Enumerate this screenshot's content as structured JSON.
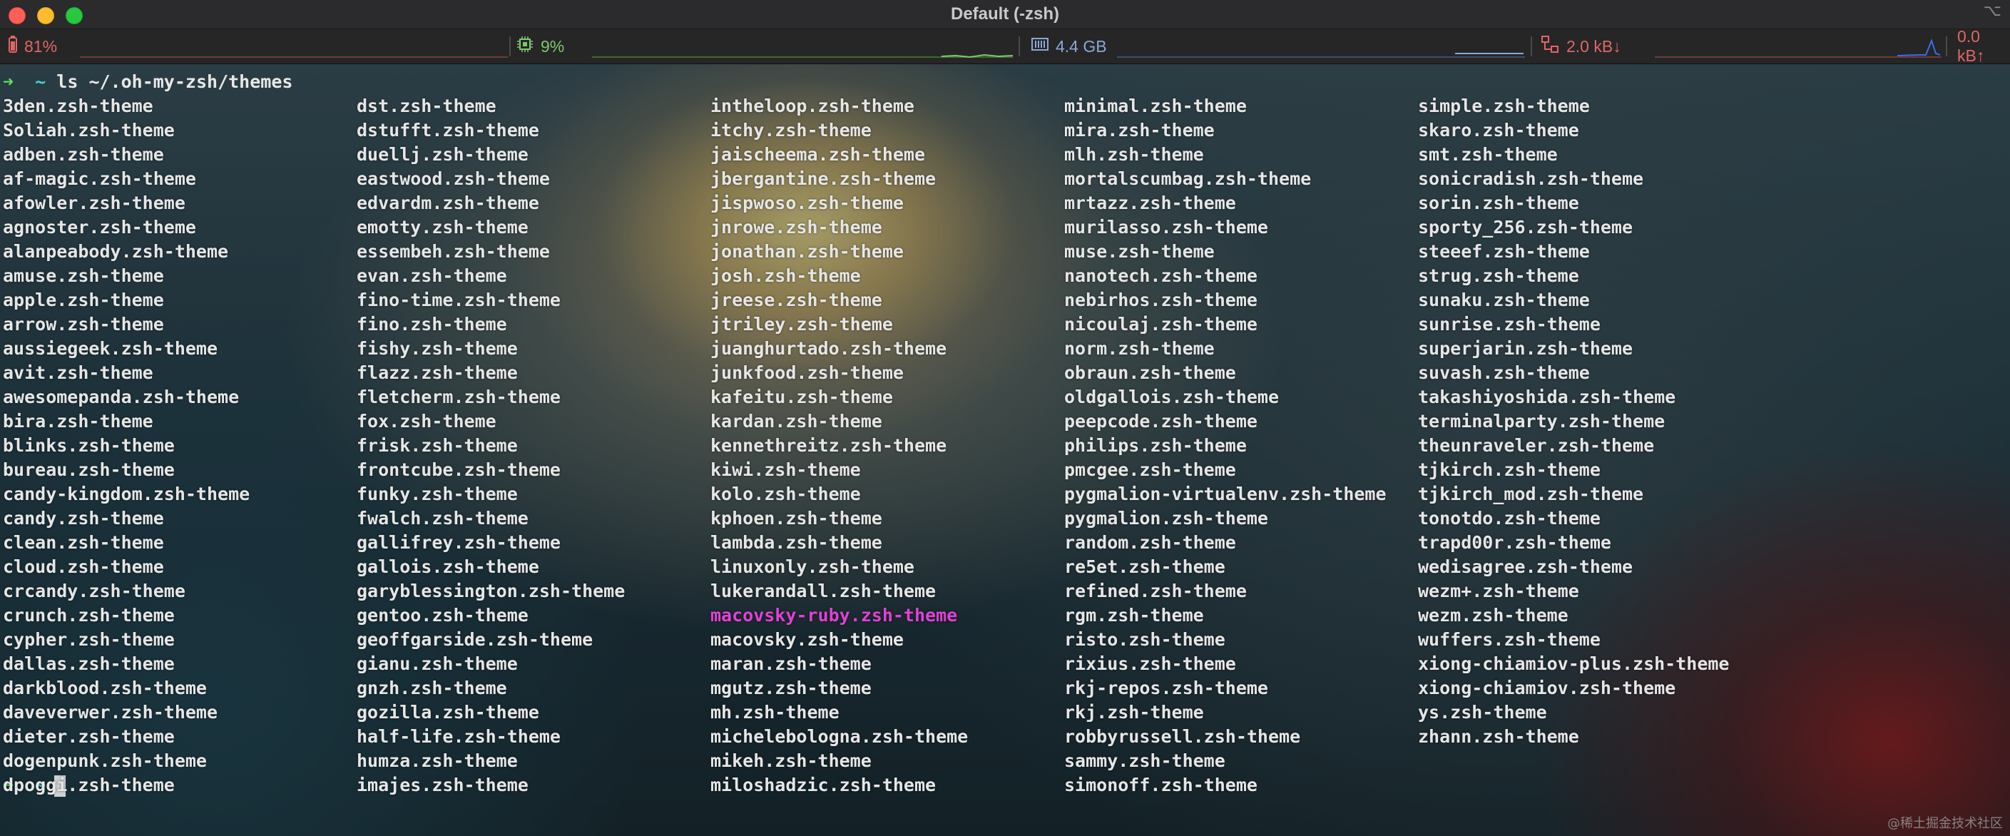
{
  "window": {
    "title": "Default (-zsh)",
    "title_icon": "⌥"
  },
  "statusbar": {
    "battery": {
      "value": "81%",
      "icon": "battery-icon",
      "color": "#e06666"
    },
    "cpu": {
      "value": "9%",
      "icon": "cpu-icon",
      "color": "#7ec96b"
    },
    "memory": {
      "value": "4.4 GB",
      "icon": "memory-icon",
      "color": "#8aa8d8"
    },
    "network_down": {
      "value": "2.0 kB↓",
      "icon": "network-icon",
      "color": "#e06666"
    },
    "network_up": {
      "value": "0.0 kB↑",
      "color": "#e06666"
    }
  },
  "terminal": {
    "prompt_arrow": "➜",
    "prompt_dir": "~",
    "command": "ls ~/.oh-my-zsh/themes",
    "highlighted_item": "macovsky-ruby.zsh-theme",
    "highlight_color": "#e141d6",
    "columns": [
      [
        "3den.zsh-theme",
        "Soliah.zsh-theme",
        "adben.zsh-theme",
        "af-magic.zsh-theme",
        "afowler.zsh-theme",
        "agnoster.zsh-theme",
        "alanpeabody.zsh-theme",
        "amuse.zsh-theme",
        "apple.zsh-theme",
        "arrow.zsh-theme",
        "aussiegeek.zsh-theme",
        "avit.zsh-theme",
        "awesomepanda.zsh-theme",
        "bira.zsh-theme",
        "blinks.zsh-theme",
        "bureau.zsh-theme",
        "candy-kingdom.zsh-theme",
        "candy.zsh-theme",
        "clean.zsh-theme",
        "cloud.zsh-theme",
        "crcandy.zsh-theme",
        "crunch.zsh-theme",
        "cypher.zsh-theme",
        "dallas.zsh-theme",
        "darkblood.zsh-theme",
        "daveverwer.zsh-theme",
        "dieter.zsh-theme",
        "dogenpunk.zsh-theme",
        "dpoggi.zsh-theme"
      ],
      [
        "dst.zsh-theme",
        "dstufft.zsh-theme",
        "duellj.zsh-theme",
        "eastwood.zsh-theme",
        "edvardm.zsh-theme",
        "emotty.zsh-theme",
        "essembeh.zsh-theme",
        "evan.zsh-theme",
        "fino-time.zsh-theme",
        "fino.zsh-theme",
        "fishy.zsh-theme",
        "flazz.zsh-theme",
        "fletcherm.zsh-theme",
        "fox.zsh-theme",
        "frisk.zsh-theme",
        "frontcube.zsh-theme",
        "funky.zsh-theme",
        "fwalch.zsh-theme",
        "gallifrey.zsh-theme",
        "gallois.zsh-theme",
        "garyblessington.zsh-theme",
        "gentoo.zsh-theme",
        "geoffgarside.zsh-theme",
        "gianu.zsh-theme",
        "gnzh.zsh-theme",
        "gozilla.zsh-theme",
        "half-life.zsh-theme",
        "humza.zsh-theme",
        "imajes.zsh-theme"
      ],
      [
        "intheloop.zsh-theme",
        "itchy.zsh-theme",
        "jaischeema.zsh-theme",
        "jbergantine.zsh-theme",
        "jispwoso.zsh-theme",
        "jnrowe.zsh-theme",
        "jonathan.zsh-theme",
        "josh.zsh-theme",
        "jreese.zsh-theme",
        "jtriley.zsh-theme",
        "juanghurtado.zsh-theme",
        "junkfood.zsh-theme",
        "kafeitu.zsh-theme",
        "kardan.zsh-theme",
        "kennethreitz.zsh-theme",
        "kiwi.zsh-theme",
        "kolo.zsh-theme",
        "kphoen.zsh-theme",
        "lambda.zsh-theme",
        "linuxonly.zsh-theme",
        "lukerandall.zsh-theme",
        "macovsky-ruby.zsh-theme",
        "macovsky.zsh-theme",
        "maran.zsh-theme",
        "mgutz.zsh-theme",
        "mh.zsh-theme",
        "michelebologna.zsh-theme",
        "mikeh.zsh-theme",
        "miloshadzic.zsh-theme"
      ],
      [
        "minimal.zsh-theme",
        "mira.zsh-theme",
        "mlh.zsh-theme",
        "mortalscumbag.zsh-theme",
        "mrtazz.zsh-theme",
        "murilasso.zsh-theme",
        "muse.zsh-theme",
        "nanotech.zsh-theme",
        "nebirhos.zsh-theme",
        "nicoulaj.zsh-theme",
        "norm.zsh-theme",
        "obraun.zsh-theme",
        "oldgallois.zsh-theme",
        "peepcode.zsh-theme",
        "philips.zsh-theme",
        "pmcgee.zsh-theme",
        "pygmalion-virtualenv.zsh-theme",
        "pygmalion.zsh-theme",
        "random.zsh-theme",
        "re5et.zsh-theme",
        "refined.zsh-theme",
        "rgm.zsh-theme",
        "risto.zsh-theme",
        "rixius.zsh-theme",
        "rkj-repos.zsh-theme",
        "rkj.zsh-theme",
        "robbyrussell.zsh-theme",
        "sammy.zsh-theme",
        "simonoff.zsh-theme"
      ],
      [
        "simple.zsh-theme",
        "skaro.zsh-theme",
        "smt.zsh-theme",
        "sonicradish.zsh-theme",
        "sorin.zsh-theme",
        "sporty_256.zsh-theme",
        "steeef.zsh-theme",
        "strug.zsh-theme",
        "sunaku.zsh-theme",
        "sunrise.zsh-theme",
        "superjarin.zsh-theme",
        "suvash.zsh-theme",
        "takashiyoshida.zsh-theme",
        "terminalparty.zsh-theme",
        "theunraveler.zsh-theme",
        "tjkirch.zsh-theme",
        "tjkirch_mod.zsh-theme",
        "tonotdo.zsh-theme",
        "trapd00r.zsh-theme",
        "wedisagree.zsh-theme",
        "wezm+.zsh-theme",
        "wezm.zsh-theme",
        "wuffers.zsh-theme",
        "xiong-chiamiov-plus.zsh-theme",
        "xiong-chiamiov.zsh-theme",
        "ys.zsh-theme",
        "zhann.zsh-theme"
      ]
    ]
  },
  "watermark": "@稀土掘金技术社区"
}
